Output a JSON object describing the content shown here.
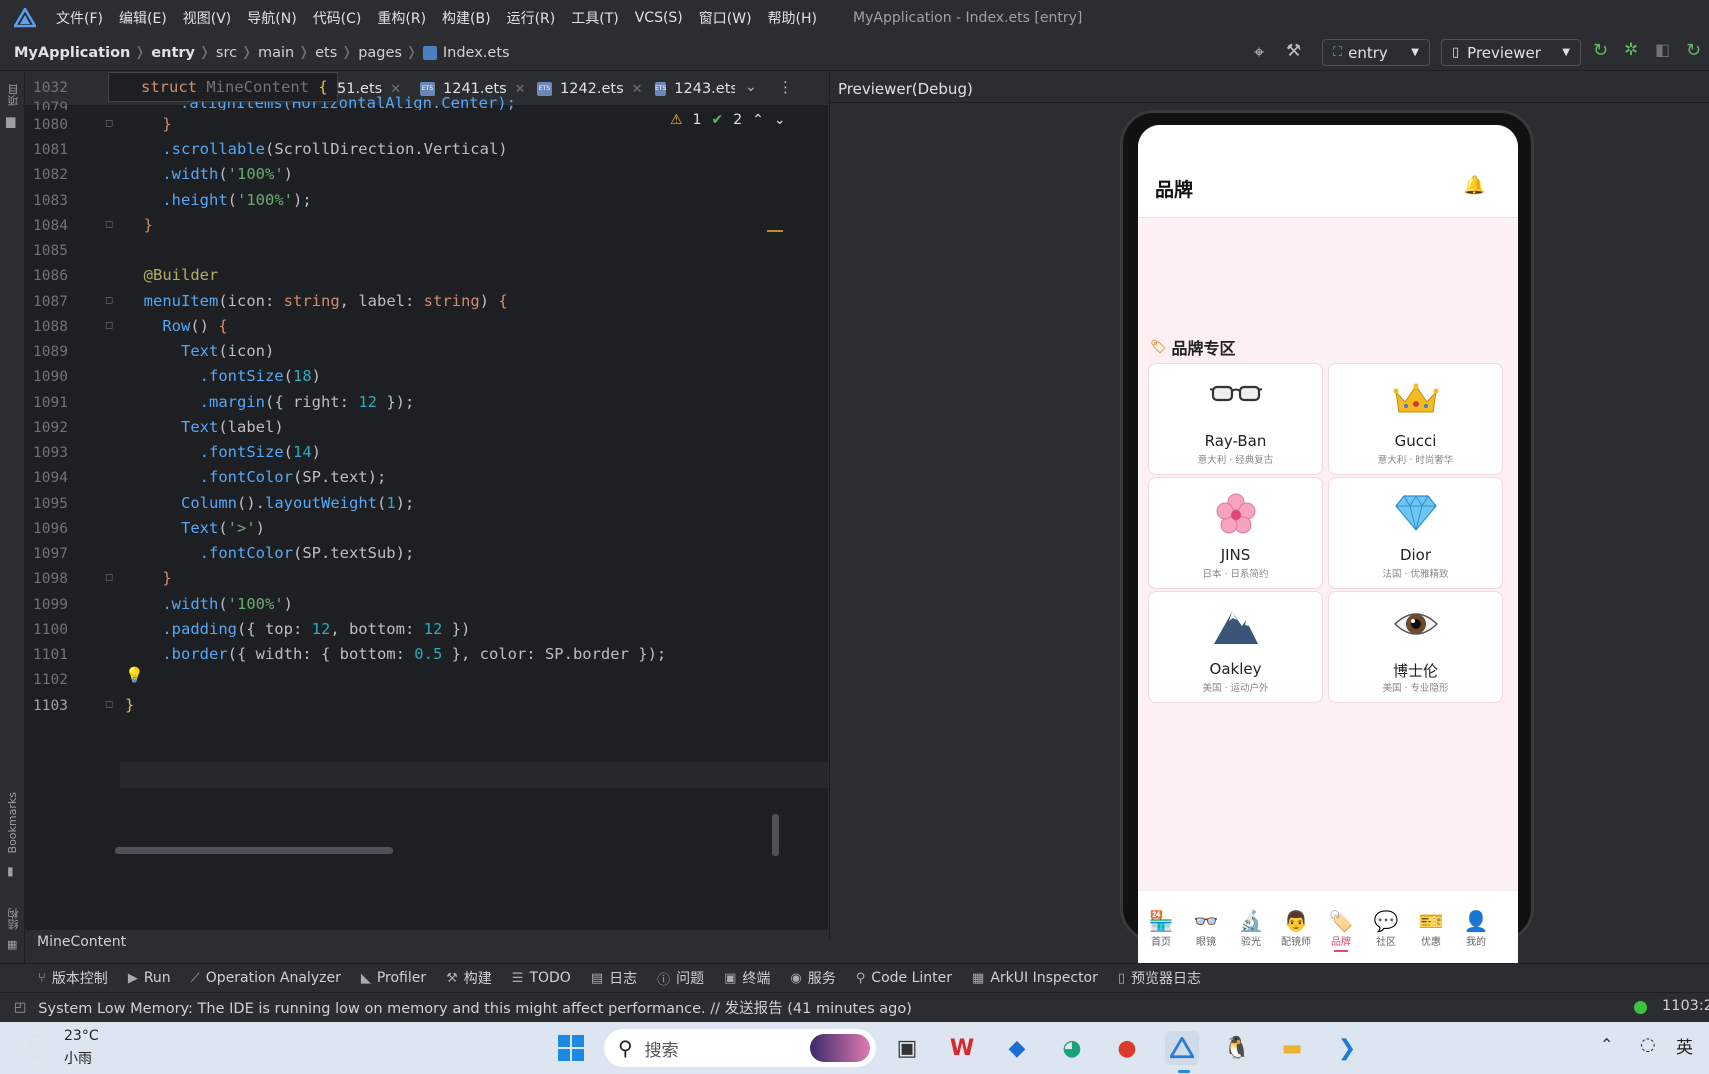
{
  "menubar": {
    "items": [
      "文件(F)",
      "编辑(E)",
      "视图(V)",
      "导航(N)",
      "代码(C)",
      "重构(R)",
      "构建(B)",
      "运行(R)",
      "工具(T)",
      "VCS(S)",
      "窗口(W)",
      "帮助(H)"
    ],
    "window_title": "MyApplication - Index.ets [entry]"
  },
  "breadcrumb": {
    "project": "MyApplication",
    "module": "entry",
    "parts": [
      "src",
      "main",
      "ets",
      "pages"
    ],
    "file": "Index.ets"
  },
  "toolbar": {
    "module_select": "entry",
    "run_config": "Previewer"
  },
  "left_stripe": {
    "project_label": "项目",
    "bookmarks_label": "Bookmarks",
    "structure_label": "结构"
  },
  "editor": {
    "sticky_line_number": "1032",
    "sticky_code": "struct MineContent {",
    "tabs": [
      "51.ets",
      "1241.ets",
      "1242.ets",
      "1243.ets"
    ],
    "inspection": {
      "warnings": "1",
      "ok": "2"
    },
    "line_numbers": [
      "1080",
      "1081",
      "1082",
      "1083",
      "1084",
      "1085",
      "1086",
      "1087",
      "1088",
      "1089",
      "1090",
      "1091",
      "1092",
      "1093",
      "1094",
      "1095",
      "1096",
      "1097",
      "1098",
      "1099",
      "1100",
      "1101",
      "1102",
      "1103"
    ],
    "partial_line_number": "1079",
    "partial_line": ".alignItems(HorizontalAlign.Center);",
    "footer_crumb": "MineContent"
  },
  "previewer": {
    "title": "Previewer(Debug)",
    "app": {
      "title": "品牌",
      "section_title": "品牌专区",
      "brands": [
        {
          "name": "Ray-Ban",
          "sub": "意大利 · 经典复古",
          "icon": "glasses"
        },
        {
          "name": "Gucci",
          "sub": "意大利 · 时尚奢华",
          "icon": "crown"
        },
        {
          "name": "JINS",
          "sub": "日本 · 日系简约",
          "icon": "cherry-blossom"
        },
        {
          "name": "Dior",
          "sub": "法国 · 优雅精致",
          "icon": "gem"
        },
        {
          "name": "Oakley",
          "sub": "美国 · 运动户外",
          "icon": "mountain"
        },
        {
          "name": "博士伦",
          "sub": "美国 · 专业隐形",
          "icon": "eye"
        }
      ],
      "nav": [
        {
          "label": "首页",
          "icon": "🏪"
        },
        {
          "label": "眼镜",
          "icon": "👓"
        },
        {
          "label": "验光",
          "icon": "🔬"
        },
        {
          "label": "配镜师",
          "icon": "👨"
        },
        {
          "label": "品牌",
          "icon": "🏷️"
        },
        {
          "label": "社区",
          "icon": "💬"
        },
        {
          "label": "优惠",
          "icon": "🎫"
        },
        {
          "label": "我的",
          "icon": "👤"
        }
      ],
      "active_nav": "品牌",
      "accent": "#e6466e"
    }
  },
  "tool_windows": [
    "版本控制",
    "Run",
    "Operation Analyzer",
    "Profiler",
    "构建",
    "TODO",
    "日志",
    "问题",
    "终端",
    "服务",
    "Code Linter",
    "ArkUI Inspector",
    "预览器日志"
  ],
  "status": {
    "message": "System Low Memory: The IDE is running low on memory and this might affect performance. // 发送报告 (41 minutes ago)",
    "position": "1103:2"
  },
  "taskbar": {
    "weather_temp": "23°C",
    "weather_desc": "小雨",
    "search_placeholder": "搜索",
    "ime": "英"
  }
}
